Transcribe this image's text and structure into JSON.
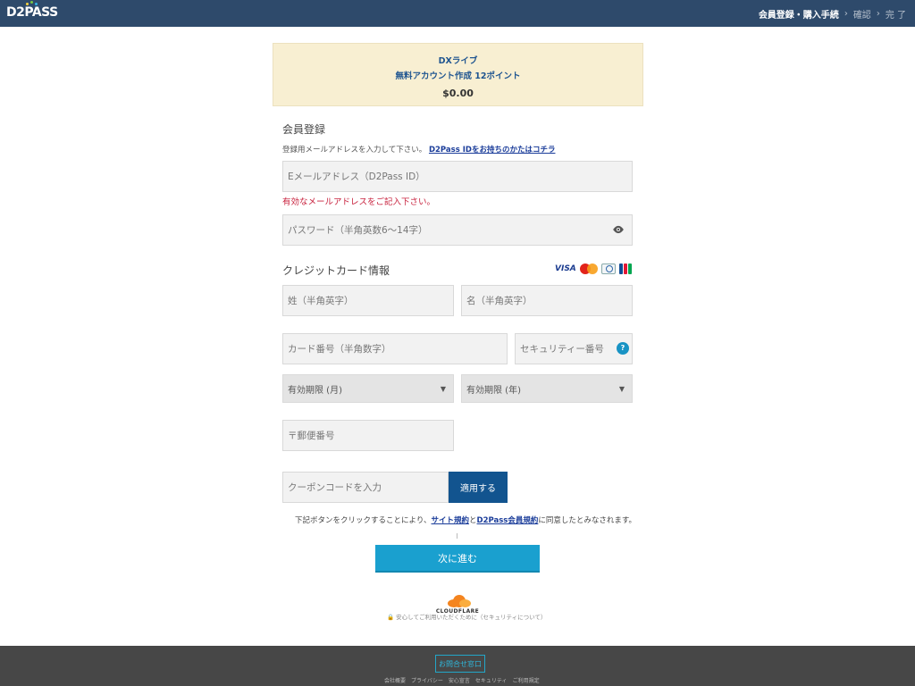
{
  "header": {
    "logo": "D2PASS",
    "steps": [
      "会員登録・購入手続",
      "確認",
      "完 了"
    ],
    "step_separator": "›"
  },
  "summary": {
    "product": "DXライブ",
    "plan": "無料アカウント作成 12ポイント",
    "price": "$0.00"
  },
  "registration": {
    "title": "会員登録",
    "hint": "登録用メールアドレスを入力して下さい。",
    "hint_link": "D2Pass IDをお持ちのかたはコチラ",
    "email_placeholder": "Eメールアドレス（D2Pass ID）",
    "email_error": "有効なメールアドレスをご記入下さい。",
    "password_placeholder": "パスワード（半角英数6〜14字）"
  },
  "credit_card": {
    "title": "クレジットカード情報",
    "brands": [
      "VISA",
      "Mastercard",
      "Diners Club",
      "JCB"
    ],
    "visa_label": "VISA",
    "last_name_placeholder": "姓（半角英字）",
    "first_name_placeholder": "名（半角英字）",
    "card_number_placeholder": "カード番号（半角数字）",
    "security_code_placeholder": "セキュリティー番号",
    "help_badge": "?",
    "exp_month": "有効期限 (月)",
    "exp_year": "有効期限 (年)",
    "postal_placeholder": "〒郵便番号",
    "caret": "▼"
  },
  "coupon": {
    "placeholder": "クーポンコードを入力",
    "apply_label": "適用する"
  },
  "agreement": {
    "text_before": "下記ボタンをクリックすることにより、",
    "link1": "サイト規約",
    "text_mid": "と",
    "link2": "D2Pass会員規約",
    "text_after": "に同意したとみなされます。"
  },
  "next_label": "次に進む",
  "cloudflare": {
    "brand": "CLOUDFLARE",
    "note": "🔒 安心してご利用いただくために（セキュリティについて）"
  },
  "footer": {
    "contact": "お問合せ窓口",
    "links": [
      "会社概要",
      "プライバシー",
      "安心宣言",
      "セキュリティ",
      "ご利用規定"
    ]
  },
  "colors": {
    "header_bg": "#2e4a6b",
    "primary_button": "#1aa0cf",
    "apply_button": "#12548f",
    "error": "#c8223e",
    "summary_bg": "#f8efd2",
    "footer_bg": "#474747"
  }
}
